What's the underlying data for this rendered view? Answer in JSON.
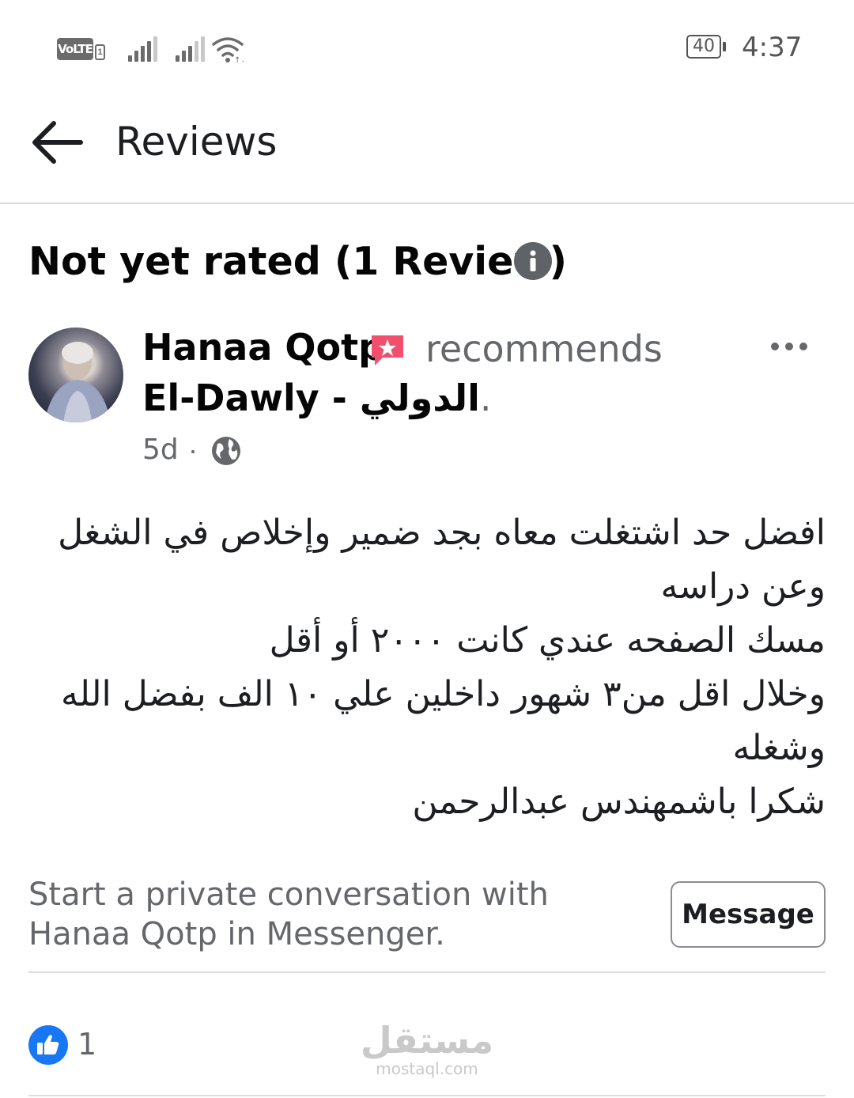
{
  "status_bar": {
    "volte": "VoLTE",
    "volte_sim": "1",
    "battery": "40",
    "time": "4:37"
  },
  "header": {
    "title": "Reviews",
    "back_icon": "arrow-left-icon"
  },
  "rating": {
    "summary": "Not yet rated (1 Review)",
    "info_icon": "info-icon"
  },
  "review": {
    "author": "Hanaa Qotp",
    "verb": "recommends",
    "page_name": "El-Dawly - الدولي",
    "page_suffix": ".",
    "time_ago": "5d",
    "separator": "·",
    "privacy_icon": "globe-icon",
    "badge_icon": "recommend-badge-icon",
    "more_icon": "more-dots-icon",
    "text_lines": [
      "افضل حد اشتغلت معاه بجد ضمير وإخلاص في الشغل",
      "وعن دراسه",
      "مسك الصفحه عندي كانت ٢٠٠٠ أو أقل",
      "وخلال اقل من٣ شهور داخلين علي ١٠ الف بفضل الله",
      "وشغله",
      "شكرا باشمهندس عبدالرحمن"
    ]
  },
  "messenger": {
    "prompt": "Start a private conversation with Hanaa Qotp in Messenger.",
    "button_label": "Message"
  },
  "reactions": {
    "like_icon": "like-thumb-icon",
    "count": "1"
  },
  "watermark": {
    "arabic": "مستقل",
    "latin": "mostaql.com"
  },
  "colors": {
    "accent_blue": "#1877f2",
    "badge_red": "#f0506e",
    "secondary_text": "#65676b"
  }
}
